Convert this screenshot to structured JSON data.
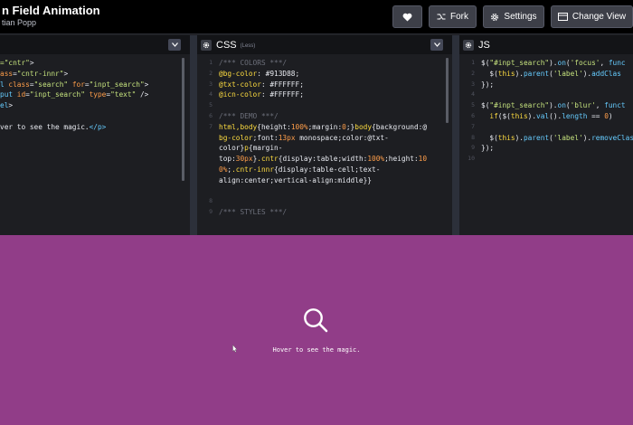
{
  "header": {
    "title": "n Field Animation",
    "author": "tian Popp",
    "fork_label": "Fork",
    "settings_label": "Settings",
    "change_view_label": "Change View"
  },
  "html_pane": {
    "lines": [
      [
        "=\"cntr\">"
      ],
      [
        "ass=\"cntr-innr\">"
      ],
      [
        "l class=\"search\" for=\"inpt_search\">"
      ],
      [
        "put id=\"inpt_search\" type=\"text\" />"
      ],
      [
        "el>"
      ],
      [
        ""
      ],
      [
        "ver to see the magic.</p>"
      ]
    ]
  },
  "css_pane": {
    "label": "CSS",
    "sublabel": "(Less)",
    "gutter": [
      "1",
      "2",
      "3",
      "4",
      "5",
      "6",
      "7",
      "",
      "",
      "",
      "",
      "",
      "",
      "8",
      "9"
    ],
    "lines": [
      "/*** COLORS ***/",
      "@bg-color: #913D88;",
      "@txt-color: #FFFFFF;",
      "@icn-color: #FFFFFF;",
      "",
      "/*** DEMO ***/",
      "html,body{height:100%;margin:0;}body{background:@",
      "bg-color;font:13px monospace;color:@txt-",
      "color}p{margin-",
      "top:30px}.cntr{display:table;width:100%;height:10",
      "0%;.cntr-innr{display:table-cell;text-",
      "align:center;vertical-align:middle}}",
      "",
      "",
      "/*** STYLES ***/"
    ]
  },
  "js_pane": {
    "label": "JS",
    "gutter": [
      "1",
      "2",
      "3",
      "4",
      "5",
      "6",
      "7",
      "8",
      "9",
      "10"
    ],
    "lines": [
      "$(\"#inpt_search\").on('focus', func",
      "  $(this).parent('label').addClas",
      "});",
      "",
      "$(\"#inpt_search\").on('blur', funct",
      "  if($(this).val().length == 0)",
      "",
      "  $(this).parent('label').removeClas",
      "});",
      ""
    ]
  },
  "preview": {
    "hint_text": "Hover to see the magic.",
    "bg_color": "#913D88"
  },
  "colors": {
    "editor_bg": "#1d1e22",
    "header_bg": "#000000",
    "accent_blue": "#66ccff",
    "accent_yellow": "#ffdd40"
  }
}
